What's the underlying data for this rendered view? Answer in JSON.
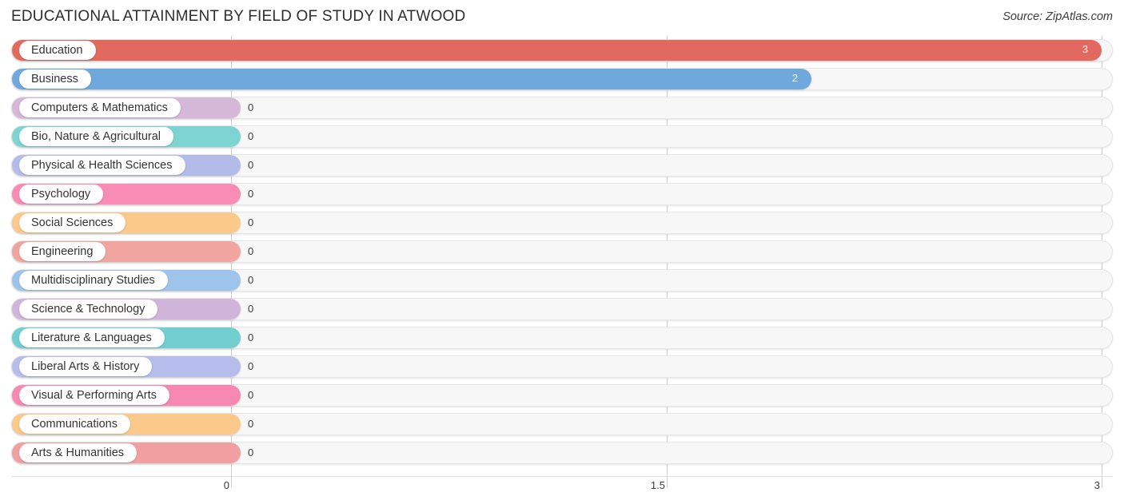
{
  "header": {
    "title": "EDUCATIONAL ATTAINMENT BY FIELD OF STUDY IN ATWOOD",
    "source": "Source: ZipAtlas.com"
  },
  "chart_data": {
    "type": "bar",
    "orientation": "horizontal",
    "title": "EDUCATIONAL ATTAINMENT BY FIELD OF STUDY IN ATWOOD",
    "xlabel": "",
    "ylabel": "",
    "xlim": [
      0,
      3
    ],
    "ticks": [
      "0",
      "1.5",
      "3"
    ],
    "tick_values": [
      0,
      1.5,
      3
    ],
    "grid": true,
    "legend": "none",
    "categories": [
      "Education",
      "Business",
      "Computers & Mathematics",
      "Bio, Nature & Agricultural",
      "Physical & Health Sciences",
      "Psychology",
      "Social Sciences",
      "Engineering",
      "Multidisciplinary Studies",
      "Science & Technology",
      "Literature & Languages",
      "Liberal Arts & History",
      "Visual & Performing Arts",
      "Communications",
      "Arts & Humanities"
    ],
    "values": [
      3,
      2,
      0,
      0,
      0,
      0,
      0,
      0,
      0,
      0,
      0,
      0,
      0,
      0,
      0
    ],
    "value_labels": [
      "3",
      "2",
      "0",
      "0",
      "0",
      "0",
      "0",
      "0",
      "0",
      "0",
      "0",
      "0",
      "0",
      "0",
      "0"
    ],
    "colors": [
      "#e2695f",
      "#6ea8dd",
      "#d5b8d8",
      "#7ed4d0",
      "#b3bce8",
      "#f98cb4",
      "#fbc98a",
      "#f0a5a0",
      "#9dc4ea",
      "#d0b4d9",
      "#72cfcf",
      "#b6bdea",
      "#f688b1",
      "#fbc98a",
      "#f0a0a0"
    ]
  },
  "axis": {
    "ticks": [
      "0",
      "1.5",
      "3"
    ]
  }
}
